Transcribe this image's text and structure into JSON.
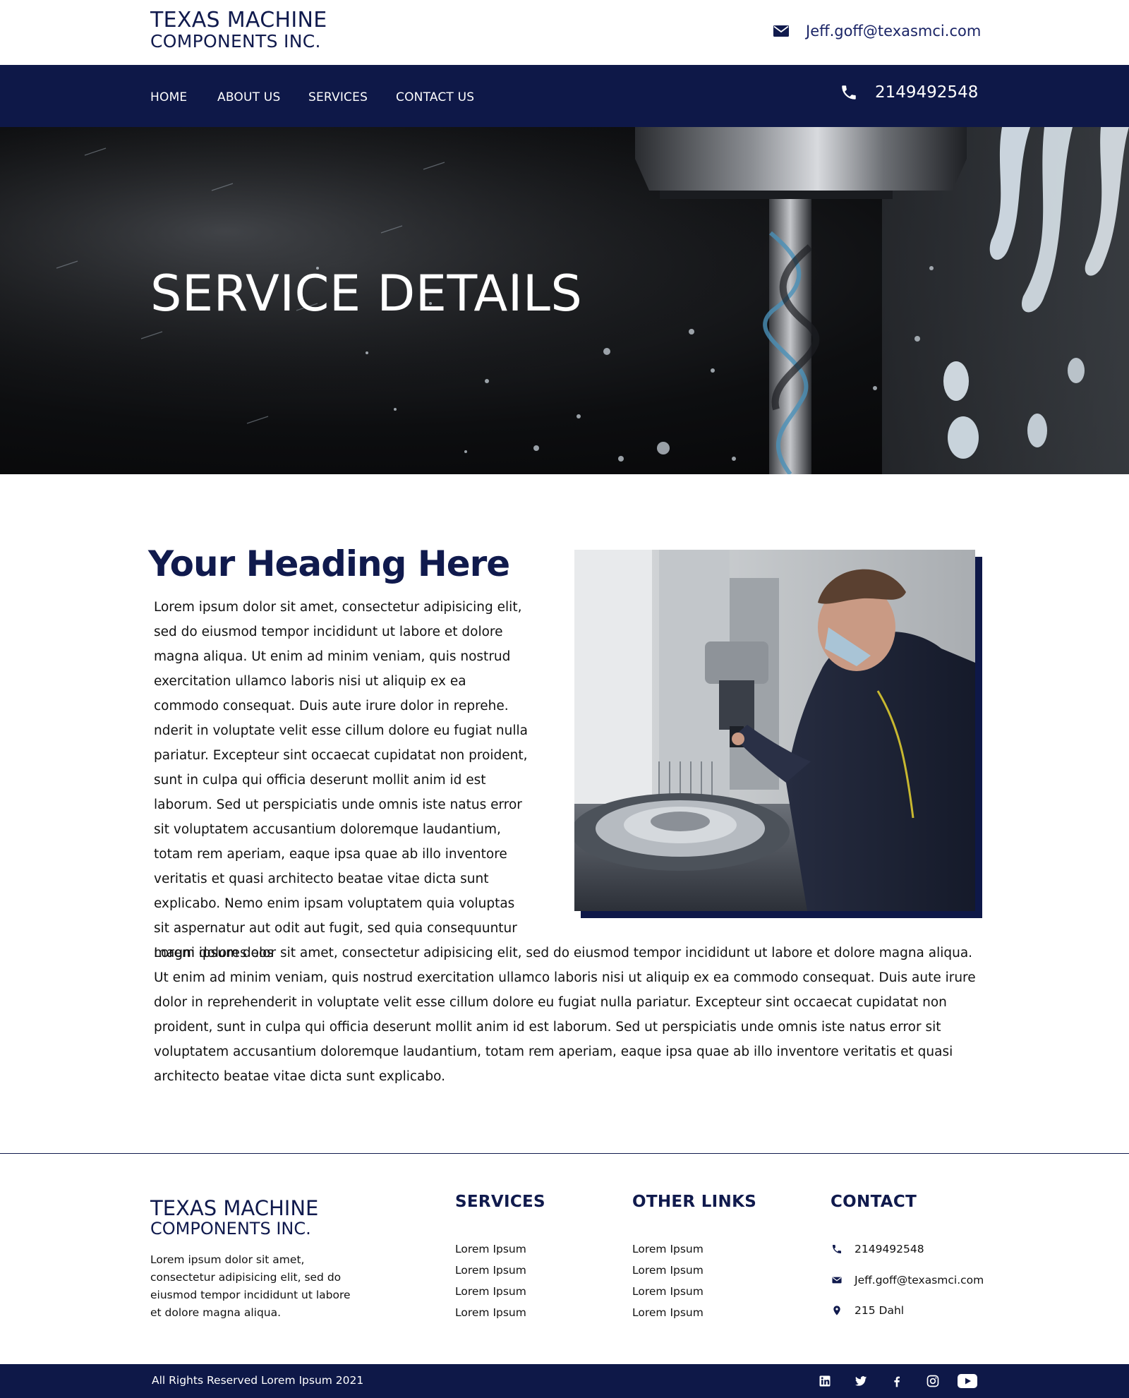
{
  "header": {
    "brand_line1": "TEXAS MACHINE",
    "brand_line2": "COMPONENTS INC.",
    "email": "Jeff.goff@texasmci.com",
    "email_icon": "envelope-icon"
  },
  "nav": {
    "items": [
      {
        "label": "HOME"
      },
      {
        "label": "ABOUT US"
      },
      {
        "label": "SERVICES"
      },
      {
        "label": "CONTACT US"
      }
    ],
    "phone": "2149492548",
    "phone_icon": "phone-icon"
  },
  "hero": {
    "title": "SERVICE DETAILS"
  },
  "content": {
    "heading": "Your Heading Here",
    "paragraph1": "Lorem ipsum dolor sit amet, consectetur adipisicing elit, sed do eiusmod tempor incididunt ut labore et dolore magna aliqua. Ut enim ad minim veniam, quis nostrud exercitation ullamco laboris nisi ut aliquip ex ea commodo consequat. Duis aute irure dolor in reprehe. nderit in voluptate velit esse cillum dolore eu fugiat nulla pariatur. Excepteur sint occaecat cupidatat non proident, sunt in culpa qui officia deserunt mollit anim id est laborum. Sed ut perspiciatis unde omnis iste natus error sit voluptatem accusantium doloremque laudantium, totam rem aperiam, eaque ipsa quae ab illo inventore veritatis et quasi architecto beatae vitae dicta sunt explicabo. Nemo enim ipsam voluptatem quia voluptas sit aspernatur aut odit aut fugit, sed quia consequuntur magni dolores eos",
    "paragraph2": "Lorem ipsum dolor sit amet, consectetur adipisicing elit, sed do eiusmod tempor incididunt ut labore et dolore magna aliqua. Ut enim ad minim veniam, quis nostrud exercitation ullamco laboris nisi ut aliquip ex ea commodo consequat. Duis aute irure dolor in reprehenderit in voluptate velit esse cillum dolore eu fugiat nulla pariatur. Excepteur sint occaecat cupidatat non proident, sunt in culpa qui officia deserunt mollit anim id est laborum. Sed ut perspiciatis unde omnis iste natus error sit voluptatem accusantium doloremque laudantium, totam rem aperiam, eaque ipsa quae ab illo inventore veritatis et quasi architecto beatae vitae dicta sunt explicabo."
  },
  "footer": {
    "brand_line1": "TEXAS MACHINE",
    "brand_line2": "COMPONENTS INC.",
    "description": "Lorem ipsum dolor sit amet, consectetur adipisicing elit, sed do eiusmod tempor incididunt ut labore et dolore magna aliqua.",
    "services": {
      "title": "SERVICES",
      "links": [
        "Lorem Ipsum",
        "Lorem Ipsum",
        "Lorem Ipsum",
        "Lorem Ipsum"
      ]
    },
    "other_links": {
      "title": "OTHER LINKS",
      "links": [
        "Lorem Ipsum",
        "Lorem Ipsum",
        "Lorem Ipsum",
        "Lorem Ipsum"
      ]
    },
    "contact": {
      "title": "CONTACT",
      "phone": "2149492548",
      "email": "Jeff.goff@texasmci.com",
      "address": "215 Dahl"
    },
    "copyright": "All Rights Reserved Lorem Ipsum 2021",
    "social": [
      "linkedin-icon",
      "twitter-icon",
      "facebook-icon",
      "instagram-icon",
      "youtube-icon"
    ]
  },
  "colors": {
    "navy": "#0e1848",
    "brand_text": "#101a4d",
    "white": "#ffffff"
  }
}
